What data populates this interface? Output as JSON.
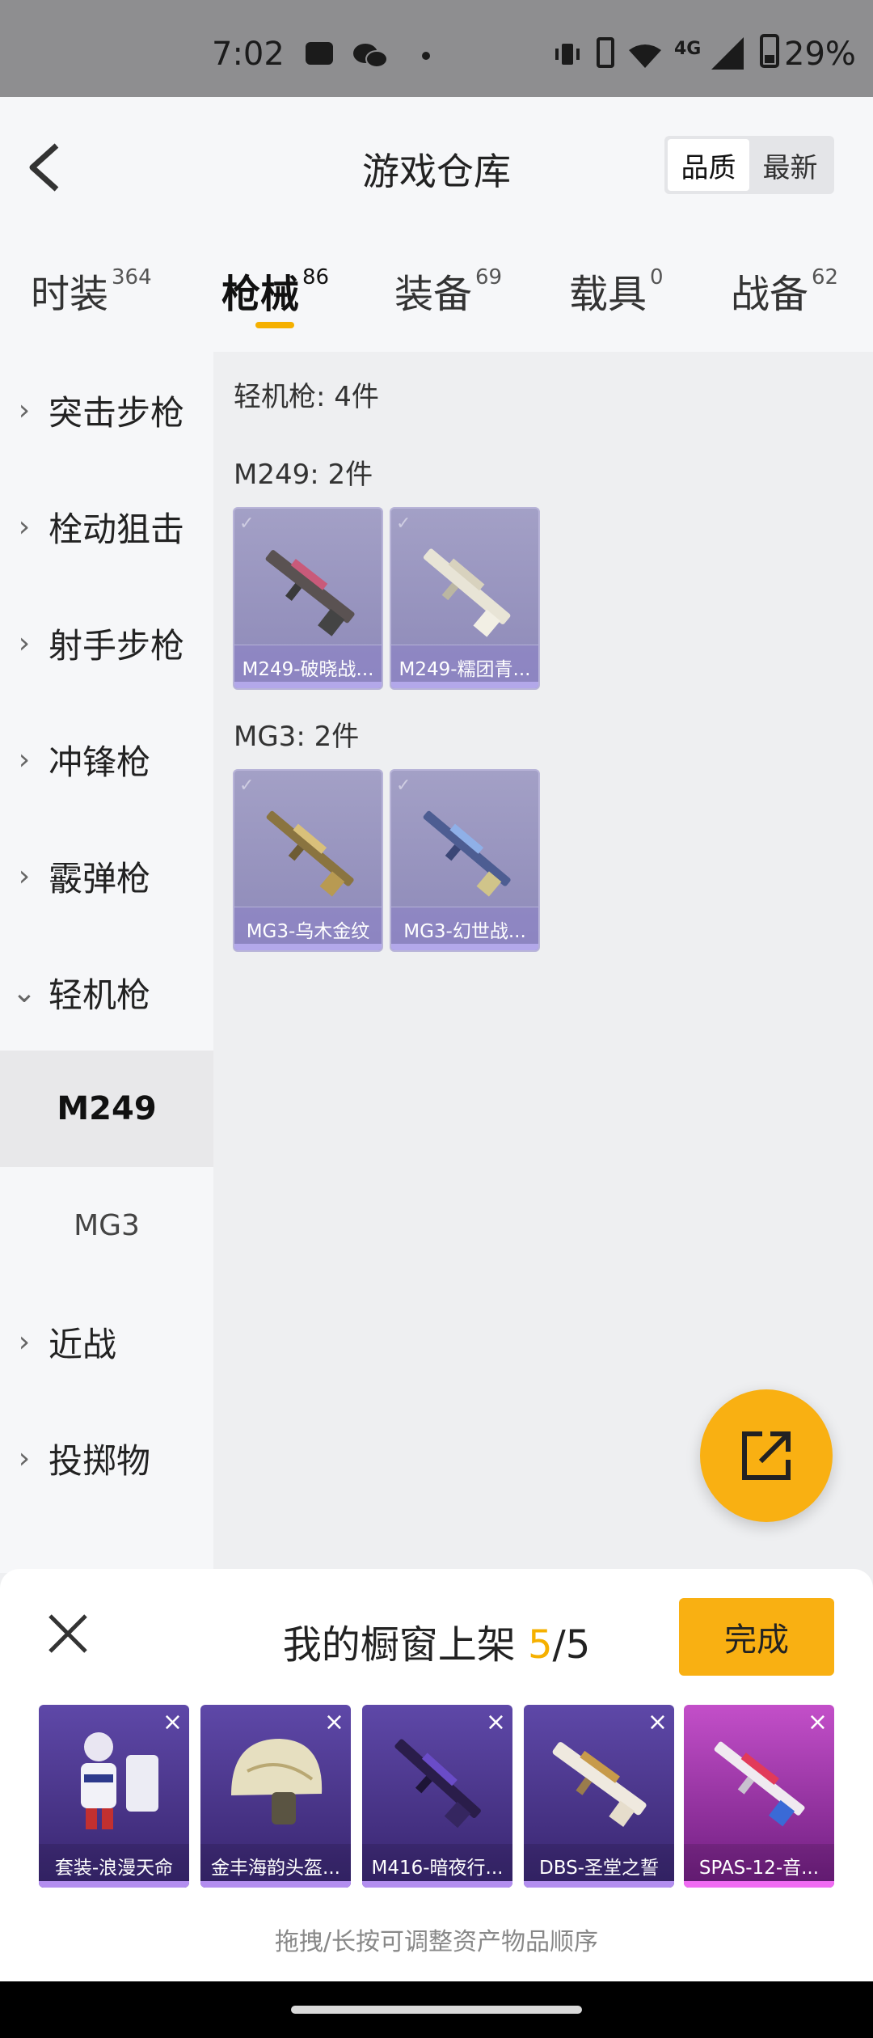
{
  "status_bar": {
    "time": "7:02",
    "network": "4G",
    "battery": "29%"
  },
  "header": {
    "title": "游戏仓库",
    "sort_options": [
      "品质",
      "最新"
    ],
    "sort_selected": "品质"
  },
  "tabs": [
    {
      "label": "时装",
      "count": "364"
    },
    {
      "label": "枪械",
      "count": "86",
      "active": true
    },
    {
      "label": "装备",
      "count": "69"
    },
    {
      "label": "载具",
      "count": "0"
    },
    {
      "label": "战备",
      "count": "62"
    }
  ],
  "sidebar": {
    "items": [
      {
        "label": "突击步枪"
      },
      {
        "label": "栓动狙击"
      },
      {
        "label": "射手步枪"
      },
      {
        "label": "冲锋枪"
      },
      {
        "label": "霰弹枪"
      },
      {
        "label": "轻机枪",
        "expanded": true
      },
      {
        "label": "M249",
        "sub": true,
        "active": true
      },
      {
        "label": "MG3",
        "sub": true
      },
      {
        "label": "近战"
      },
      {
        "label": "投掷物"
      }
    ]
  },
  "content": {
    "category_count": "轻机枪: 4件",
    "groups": [
      {
        "title": "M249: 2件",
        "items": [
          "M249-破晓战...",
          "M249-糯团青..."
        ]
      },
      {
        "title": "MG3: 2件",
        "items": [
          "MG3-乌木金纹",
          "MG3-幻世战..."
        ]
      }
    ]
  },
  "showcase": {
    "title_prefix": "我的橱窗上架 ",
    "current": "5",
    "total": "/5",
    "done_label": "完成",
    "items": [
      "套装-浪漫天命",
      "金丰海韵头盔...",
      "M416-暗夜行...",
      "DBS-圣堂之誓",
      "SPAS-12-音..."
    ],
    "hint": "拖拽/长按可调整资产物品顺序"
  },
  "colors": {
    "accent": "#f9b012",
    "card_purple": "#9a97c2",
    "legend_purple": "#4a3590",
    "pink": "#b03cb8"
  }
}
